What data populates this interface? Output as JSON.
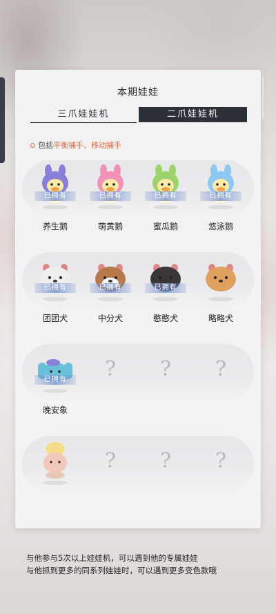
{
  "panel": {
    "title": "本期娃娃",
    "tabs": [
      {
        "label": "三爪娃娃机",
        "active": false
      },
      {
        "label": "二爪娃娃机",
        "active": true
      }
    ],
    "note": {
      "prefix": "包括",
      "highlight": "平衡捕手、移动捕手"
    }
  },
  "owned_label": "已拥有",
  "rows": [
    {
      "items": [
        {
          "name": "养生鹅",
          "owned": true,
          "icon": "purple-hood-duck-icon",
          "color": "#8a7fd9"
        },
        {
          "name": "萌黄鹅",
          "owned": true,
          "icon": "pink-hood-duck-icon",
          "color": "#f291b8"
        },
        {
          "name": "蜜瓜鹅",
          "owned": true,
          "icon": "green-hood-duck-icon",
          "color": "#9bd46b"
        },
        {
          "name": "悠泳鹅",
          "owned": true,
          "icon": "blue-hood-duck-icon",
          "color": "#8cc8f0"
        }
      ]
    },
    {
      "items": [
        {
          "name": "团团犬",
          "owned": true,
          "icon": "white-dog-icon",
          "color": "#efeeee"
        },
        {
          "name": "中分犬",
          "owned": true,
          "icon": "brown-white-dog-icon",
          "color": "#b8784a"
        },
        {
          "name": "憨憨犬",
          "owned": true,
          "icon": "black-dog-icon",
          "color": "#3b3636"
        },
        {
          "name": "略略犬",
          "owned": false,
          "icon": "orange-dog-icon",
          "color": "#e0a15e"
        }
      ]
    },
    {
      "items": [
        {
          "name": "晚安象",
          "owned": true,
          "icon": "blue-elephant-icon",
          "color": "#69c0d8"
        },
        {
          "name": "",
          "owned": false,
          "icon": "question-mark-icon"
        },
        {
          "name": "",
          "owned": false,
          "icon": "question-mark-icon"
        },
        {
          "name": "",
          "owned": false,
          "icon": "question-mark-icon"
        }
      ]
    },
    {
      "items": [
        {
          "name": "",
          "owned": false,
          "icon": "ice-cream-bear-icon",
          "color": "#f2c9b8"
        },
        {
          "name": "",
          "owned": false,
          "icon": "question-mark-icon"
        },
        {
          "name": "",
          "owned": false,
          "icon": "question-mark-icon"
        },
        {
          "name": "",
          "owned": false,
          "icon": "question-mark-icon"
        }
      ]
    }
  ],
  "unknown_mark": "?",
  "footer": {
    "line1": "与他参与5次以上娃娃机，可以遇到他的专属娃娃",
    "line2": "与他抓到更多的同系列娃娃时，可以遇到更多变色款哦"
  }
}
